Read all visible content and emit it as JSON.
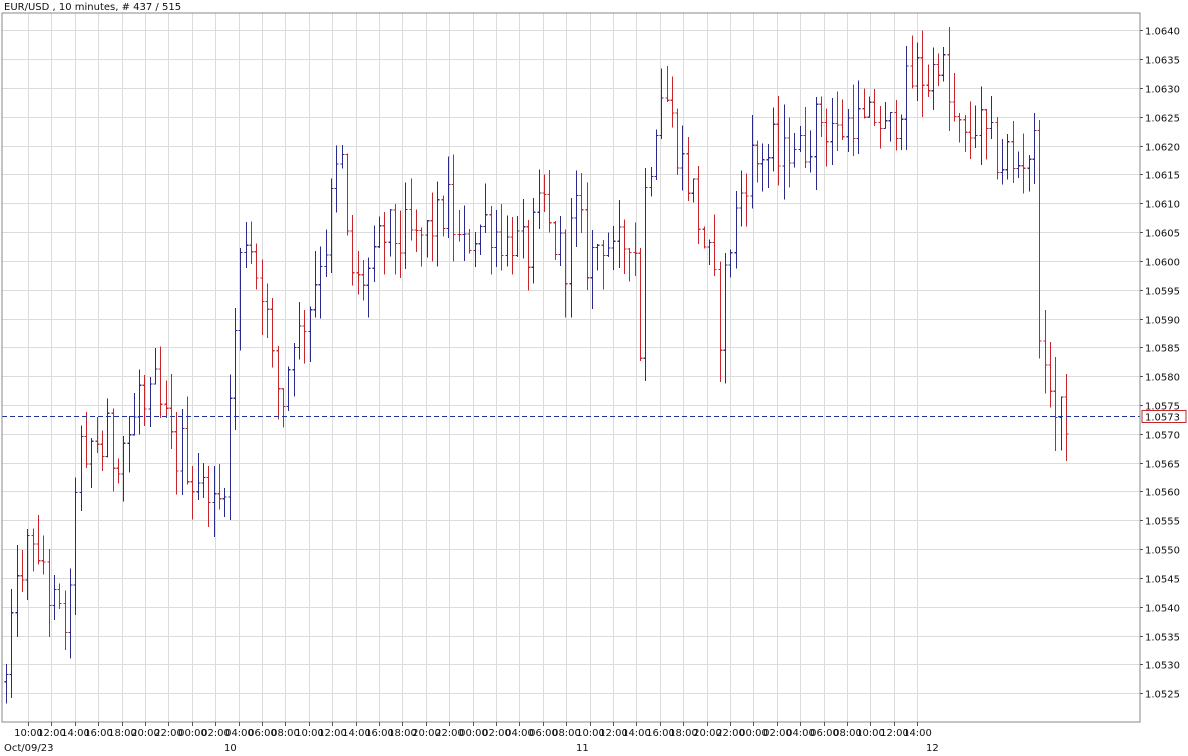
{
  "chart_data": {
    "type": "ohlc",
    "title": "EUR/USD , 10 minutes, # 437 / 515",
    "ylim": [
      1.052,
      1.0643
    ],
    "yticks": [
      "1.0525",
      "1.0530",
      "1.0535",
      "1.0540",
      "1.0545",
      "1.0550",
      "1.0555",
      "1.0560",
      "1.0565",
      "1.0570",
      "1.0575",
      "1.0580",
      "1.0585",
      "1.0590",
      "1.0595",
      "1.0600",
      "1.0605",
      "1.0610",
      "1.0615",
      "1.0620",
      "1.0625",
      "1.0630",
      "1.0635",
      "1.0640"
    ],
    "xticks": [
      "10:00",
      "12:00",
      "14:00",
      "16:00",
      "18:00",
      "20:00",
      "22:00",
      "00:00",
      "02:00",
      "04:00",
      "06:00",
      "08:00",
      "10:00",
      "12:00",
      "14:00",
      "16:00",
      "18:00",
      "20:00",
      "22:00",
      "00:00",
      "02:00",
      "04:00",
      "06:00",
      "08:00",
      "10:00",
      "12:00",
      "14:00",
      "16:00",
      "18:00",
      "20:00",
      "22:00",
      "00:00",
      "02:00",
      "04:00",
      "06:00",
      "08:00",
      "10:00",
      "12:00",
      "14:00"
    ],
    "day_labels": [
      "Oct/09/23",
      "10",
      "11",
      "12"
    ],
    "current_price": "1.0573",
    "grid": true,
    "colors": {
      "up": "#2a2a8c",
      "down": "#c8242a",
      "current_line": "#2030a0"
    },
    "anchors": [
      [
        0,
        1.0527
      ],
      [
        1,
        1.0535
      ],
      [
        2,
        1.0548
      ],
      [
        3,
        1.0542
      ],
      [
        4,
        1.055
      ],
      [
        5,
        1.0553
      ],
      [
        6,
        1.0545
      ],
      [
        7,
        1.0548
      ],
      [
        8,
        1.0542
      ],
      [
        9,
        1.054
      ],
      [
        10,
        1.0538
      ],
      [
        11,
        1.0537
      ],
      [
        12,
        1.054
      ],
      [
        13,
        1.0562
      ],
      [
        14,
        1.0567
      ],
      [
        15,
        1.0562
      ],
      [
        16,
        1.0568
      ],
      [
        17,
        1.0569
      ],
      [
        18,
        1.0567
      ],
      [
        19,
        1.057
      ],
      [
        20,
        1.0566
      ],
      [
        21,
        1.0567
      ],
      [
        22,
        1.0569
      ],
      [
        23,
        1.057
      ],
      [
        24,
        1.0572
      ],
      [
        25,
        1.0578
      ],
      [
        26,
        1.0573
      ],
      [
        27,
        1.0575
      ],
      [
        28,
        1.0578
      ],
      [
        29,
        1.0574
      ],
      [
        30,
        1.0572
      ],
      [
        31,
        1.0568
      ],
      [
        32,
        1.0566
      ],
      [
        33,
        1.0568
      ],
      [
        34,
        1.0565
      ],
      [
        35,
        1.0562
      ],
      [
        36,
        1.0563
      ],
      [
        37,
        1.056
      ],
      [
        38,
        1.0562
      ],
      [
        39,
        1.0557
      ],
      [
        40,
        1.0558
      ],
      [
        41,
        1.0563
      ],
      [
        42,
        1.0575
      ],
      [
        43,
        1.0588
      ],
      [
        44,
        1.06
      ],
      [
        45,
        1.0605
      ],
      [
        46,
        1.0603
      ],
      [
        47,
        1.0598
      ],
      [
        48,
        1.0596
      ],
      [
        49,
        1.059
      ],
      [
        50,
        1.0582
      ],
      [
        51,
        1.0578
      ],
      [
        52,
        1.0576
      ],
      [
        53,
        1.0582
      ],
      [
        54,
        1.0588
      ],
      [
        55,
        1.0587
      ],
      [
        56,
        1.059
      ],
      [
        57,
        1.0593
      ],
      [
        58,
        1.0597
      ],
      [
        59,
        1.0601
      ],
      [
        60,
        1.0603
      ],
      [
        61,
        1.061
      ],
      [
        62,
        1.0615
      ],
      [
        63,
        1.0617
      ],
      [
        64,
        1.0603
      ],
      [
        65,
        1.0598
      ],
      [
        66,
        1.0596
      ],
      [
        67,
        1.0597
      ],
      [
        68,
        1.0598
      ],
      [
        69,
        1.0599
      ],
      [
        70,
        1.0603
      ],
      [
        71,
        1.0604
      ],
      [
        72,
        1.0605
      ],
      [
        73,
        1.0604
      ],
      [
        74,
        1.0603
      ],
      [
        75,
        1.0605
      ],
      [
        76,
        1.0604
      ],
      [
        77,
        1.0603
      ],
      [
        78,
        1.0604
      ],
      [
        79,
        1.0605
      ],
      [
        80,
        1.0606
      ],
      [
        81,
        1.0607
      ],
      [
        82,
        1.0608
      ],
      [
        83,
        1.061
      ],
      [
        84,
        1.0606
      ],
      [
        85,
        1.0603
      ],
      [
        86,
        1.0602
      ],
      [
        87,
        1.0604
      ],
      [
        88,
        1.0605
      ],
      [
        89,
        1.0606
      ],
      [
        90,
        1.0607
      ],
      [
        91,
        1.0606
      ],
      [
        92,
        1.0605
      ],
      [
        93,
        1.0604
      ],
      [
        94,
        1.0603
      ],
      [
        95,
        1.0604
      ],
      [
        96,
        1.0603
      ],
      [
        97,
        1.0602
      ],
      [
        98,
        1.0601
      ],
      [
        99,
        1.0605
      ],
      [
        100,
        1.0608
      ],
      [
        101,
        1.061
      ],
      [
        102,
        1.0605
      ],
      [
        103,
        1.0603
      ],
      [
        104,
        1.0602
      ],
      [
        105,
        1.06
      ],
      [
        106,
        1.0605
      ],
      [
        107,
        1.0609
      ],
      [
        108,
        1.0605
      ],
      [
        109,
        1.06
      ],
      [
        110,
        1.0601
      ],
      [
        111,
        1.0603
      ],
      [
        112,
        1.0604
      ],
      [
        113,
        1.0603
      ],
      [
        114,
        1.06
      ],
      [
        115,
        1.0602
      ],
      [
        116,
        1.0603
      ],
      [
        117,
        1.0605
      ],
      [
        118,
        1.0602
      ],
      [
        119,
        1.0585
      ],
      [
        120,
        1.0612
      ],
      [
        121,
        1.0618
      ],
      [
        122,
        1.0625
      ],
      [
        123,
        1.063
      ],
      [
        124,
        1.0628
      ],
      [
        125,
        1.0624
      ],
      [
        126,
        1.062
      ],
      [
        127,
        1.0617
      ],
      [
        128,
        1.0614
      ],
      [
        129,
        1.0612
      ],
      [
        130,
        1.0607
      ],
      [
        131,
        1.0603
      ],
      [
        132,
        1.06
      ],
      [
        133,
        1.0595
      ],
      [
        134,
        1.0588
      ],
      [
        135,
        1.0597
      ],
      [
        136,
        1.0603
      ],
      [
        137,
        1.0608
      ],
      [
        138,
        1.0612
      ],
      [
        139,
        1.0615
      ],
      [
        140,
        1.0618
      ],
      [
        141,
        1.0617
      ],
      [
        142,
        1.0619
      ],
      [
        143,
        1.0618
      ],
      [
        144,
        1.062
      ],
      [
        145,
        1.0617
      ],
      [
        146,
        1.0618
      ],
      [
        147,
        1.062
      ],
      [
        148,
        1.0621
      ],
      [
        149,
        1.0619
      ],
      [
        150,
        1.062
      ],
      [
        151,
        1.0622
      ],
      [
        152,
        1.0624
      ],
      [
        153,
        1.0625
      ],
      [
        154,
        1.0623
      ],
      [
        155,
        1.0624
      ],
      [
        156,
        1.0622
      ],
      [
        157,
        1.0623
      ],
      [
        158,
        1.0624
      ],
      [
        159,
        1.0625
      ],
      [
        160,
        1.0624
      ],
      [
        161,
        1.0623
      ],
      [
        162,
        1.0624
      ],
      [
        163,
        1.0625
      ],
      [
        164,
        1.0624
      ],
      [
        165,
        1.0622
      ],
      [
        166,
        1.0623
      ],
      [
        167,
        1.0625
      ],
      [
        168,
        1.0628
      ],
      [
        169,
        1.063
      ],
      [
        170,
        1.0631
      ],
      [
        171,
        1.0633
      ],
      [
        172,
        1.0632
      ],
      [
        173,
        1.0631
      ],
      [
        174,
        1.0633
      ],
      [
        175,
        1.0636
      ],
      [
        176,
        1.0633
      ],
      [
        177,
        1.0627
      ],
      [
        178,
        1.0624
      ],
      [
        179,
        1.0622
      ],
      [
        180,
        1.062
      ],
      [
        181,
        1.0622
      ],
      [
        182,
        1.0624
      ],
      [
        183,
        1.0623
      ],
      [
        184,
        1.0621
      ],
      [
        185,
        1.062
      ],
      [
        186,
        1.0618
      ],
      [
        187,
        1.0617
      ],
      [
        188,
        1.0619
      ],
      [
        189,
        1.0615
      ],
      [
        190,
        1.0617
      ],
      [
        191,
        1.0618
      ],
      [
        192,
        1.0619
      ],
      [
        193,
        1.062
      ],
      [
        194,
        1.059
      ],
      [
        195,
        1.0578
      ],
      [
        196,
        1.058
      ],
      [
        197,
        1.0573
      ]
    ]
  }
}
